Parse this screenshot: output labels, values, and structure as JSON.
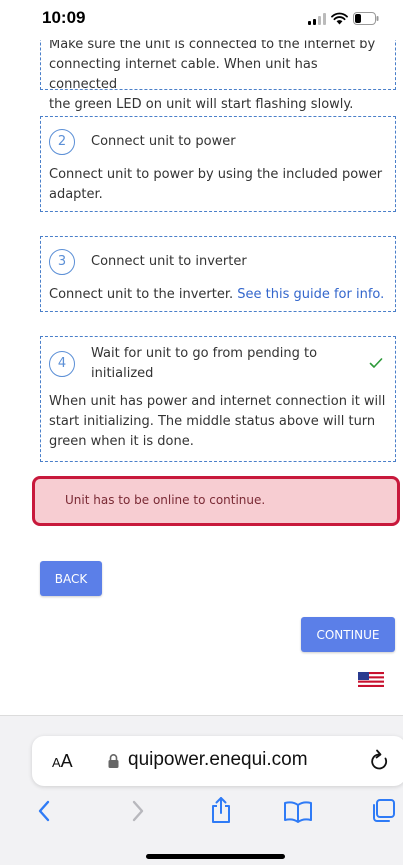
{
  "status_bar": {
    "time": "10:09"
  },
  "steps": [
    {
      "number": "",
      "title": "",
      "description_lines": [
        "Make sure the unit is connected to the internet by",
        "connecting internet cable. When unit has connected",
        "the green LED on unit will start flashing slowly."
      ]
    },
    {
      "number": "2",
      "title": "Connect unit to power",
      "description_lines": [
        "Connect unit to power by using the included power",
        "adapter."
      ]
    },
    {
      "number": "3",
      "title": "Connect unit to inverter",
      "description_text": "Connect unit to the inverter. ",
      "description_link": "See this guide for info."
    },
    {
      "number": "4",
      "title_lines": [
        "Wait for unit to go from pending to",
        "initialized"
      ],
      "completed": true,
      "description_lines": [
        "When unit has power and internet connection it will",
        "start initializing. The middle status above will turn",
        "green when it is done."
      ]
    }
  ],
  "error": {
    "message": "Unit has to be online to continue."
  },
  "buttons": {
    "back": "BACK",
    "continue": "CONTINUE"
  },
  "language": {
    "flag": "us-flag-icon"
  },
  "browser": {
    "aa_big": "A",
    "aa_small": "A",
    "url": "quipower.enequi.com"
  },
  "colors": {
    "accent": "#5b7fe8",
    "step_border": "#4a7fc9",
    "error_border": "#c8193c",
    "error_bg": "#f7cdd2",
    "check": "#2e9a3a",
    "ios_blue": "#2f7bf6"
  }
}
